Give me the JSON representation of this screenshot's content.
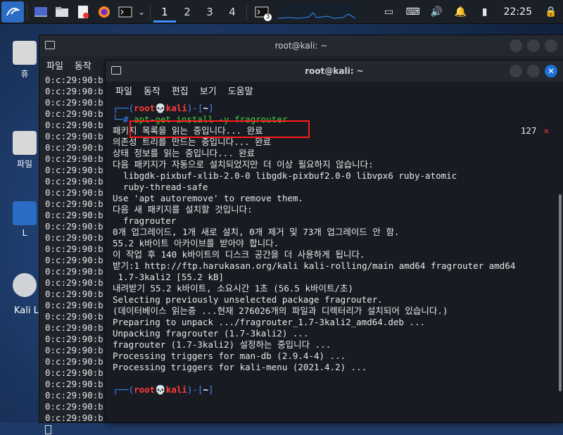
{
  "desktop": {
    "icons": [
      {
        "label": "휴"
      },
      {
        "label": "파일"
      },
      {
        "label": "L"
      }
    ],
    "bottom_label": "Kali L"
  },
  "panel": {
    "workspaces": [
      "1",
      "2",
      "3",
      "4"
    ],
    "active_workspace": "1",
    "terminal_badge": "3",
    "clock": "22:25"
  },
  "back_window": {
    "title": "root@kali: ~",
    "menu": [
      "파일",
      "동작"
    ],
    "line_prefix": "0:c:29:90:b",
    "line_count": 31
  },
  "front_window": {
    "title": "root@kali: ~",
    "menu": [
      "파일",
      "동작",
      "편집",
      "보기",
      "도움말"
    ],
    "prompt": {
      "user": "root",
      "host": "kali",
      "dir": "~"
    },
    "command": "apt-get install -y fragrouter",
    "exit_status": "127",
    "output": [
      "패키지 목록을 읽는 중입니다... 완료",
      "의존성 트리를 만드는 중입니다... 완료",
      "상태 정보를 읽는 중입니다... 완료",
      "다음 패키지가 자동으로 설치되었지만 더 이상 필요하지 않습니다:",
      "  libgdk-pixbuf-xlib-2.0-0 libgdk-pixbuf2.0-0 libvpx6 ruby-atomic",
      "  ruby-thread-safe",
      "Use 'apt autoremove' to remove them.",
      "다음 새 패키지를 설치할 것입니다:",
      "  fragrouter",
      "0개 업그레이드, 1개 새로 설치, 0개 제거 및 73개 업그레이드 안 함.",
      "55.2 k바이트 아카이브를 받아야 합니다.",
      "이 작업 후 140 k바이트의 디스크 공간을 더 사용하게 됩니다.",
      "받기:1 http://ftp.harukasan.org/kali kali-rolling/main amd64 fragrouter amd64",
      " 1.7-3kali2 [55.2 kB]",
      "내려받기 55.2 k바이트, 소요시간 1초 (56.5 k바이트/초)",
      "Selecting previously unselected package fragrouter.",
      "(데이터베이스 읽는중 ...현재 276026개의 파일과 디렉터리가 설치되어 있습니다.)",
      "Preparing to unpack .../fragrouter_1.7-3kali2_amd64.deb ...",
      "Unpacking fragrouter (1.7-3kali2) ...",
      "fragrouter (1.7-3kali2) 설정하는 중입니다 ...",
      "Processing triggers for man-db (2.9.4-4) ...",
      "Processing triggers for kali-menu (2021.4.2) ..."
    ]
  },
  "colors": {
    "accent_blue": "#3b8cff",
    "prompt_red": "#ff3b3b",
    "command_green": "#3ed13e",
    "highlight_box": "#ff1a1a"
  }
}
